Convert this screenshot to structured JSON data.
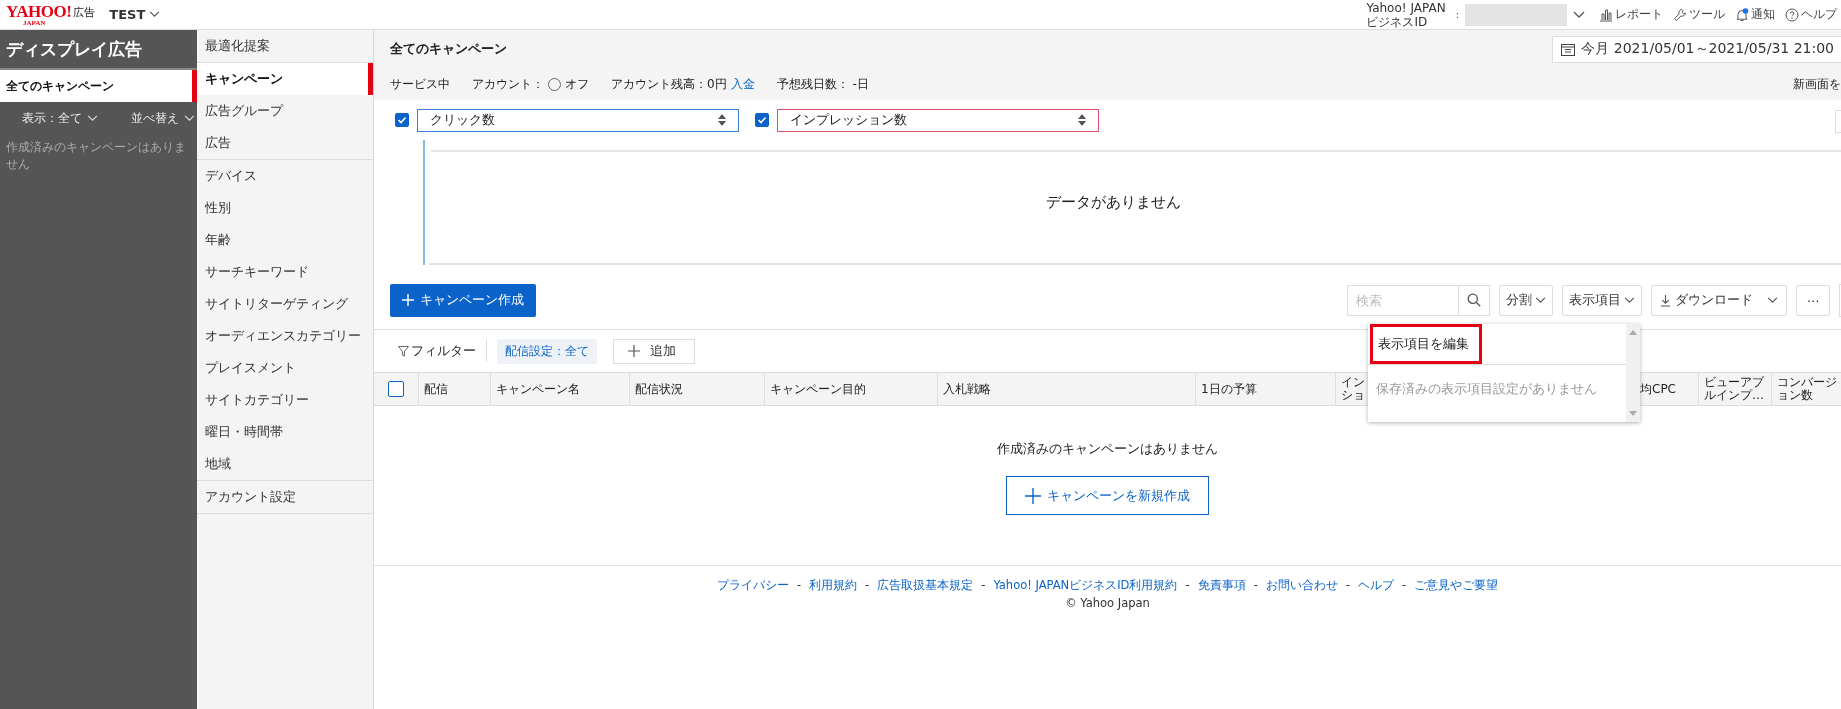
{
  "header": {
    "logo": {
      "brand": "YAHOO!",
      "sub": "JAPAN",
      "product": "広告"
    },
    "account": "TEST",
    "business_id_label": [
      "Yahoo! JAPAN",
      "ビジネスID"
    ],
    "separator": ":",
    "links": [
      {
        "label": "レポート",
        "kind": "chart"
      },
      {
        "label": "ツール",
        "kind": "wrench"
      },
      {
        "label": "通知",
        "kind": "bell",
        "badge": true
      },
      {
        "label": "ヘルプ",
        "kind": "help"
      }
    ]
  },
  "sidebar": {
    "title": "ディスプレイ広告",
    "items": [
      {
        "label": "全てのキャンペーン",
        "selected": true
      }
    ],
    "filters": [
      "表示：全て",
      "並べ替え"
    ],
    "empty": "作成済みのキャンペーンはありません"
  },
  "nav": {
    "groups": [
      {
        "items": [
          {
            "label": "最適化提案",
            "selected": false
          }
        ]
      },
      {
        "items": [
          {
            "label": "キャンペーン",
            "selected": true
          },
          {
            "label": "広告グループ",
            "selected": false
          },
          {
            "label": "広告",
            "selected": false
          }
        ]
      },
      {
        "items": [
          {
            "label": "デバイス",
            "selected": false
          },
          {
            "label": "性別",
            "selected": false
          },
          {
            "label": "年齢",
            "selected": false
          },
          {
            "label": "サーチキーワード",
            "selected": false
          },
          {
            "label": "サイトリターゲティング",
            "selected": false
          },
          {
            "label": "オーディエンスカテゴリー",
            "selected": false
          },
          {
            "label": "プレイスメント",
            "selected": false
          },
          {
            "label": "サイトカテゴリー",
            "selected": false
          },
          {
            "label": "曜日・時間帯",
            "selected": false
          },
          {
            "label": "地域",
            "selected": false
          }
        ]
      },
      {
        "items": [
          {
            "label": "アカウント設定",
            "selected": false
          }
        ]
      }
    ]
  },
  "main": {
    "title": "全てのキャンペーン",
    "date_range": "今月 2021/05/01～2021/05/31 21:00",
    "status": {
      "service": "サービス中",
      "account_label": "アカウント：",
      "account_radio": {
        "label": "オフ",
        "selected": false
      },
      "balance": "アカウント残高：0円",
      "deposit_link": "入金",
      "days_left": "予想残日数： -日",
      "new_screen": "新画面を"
    },
    "metrics": [
      {
        "checked": true,
        "label": "クリック数",
        "color": "#3a7fd0"
      },
      {
        "checked": true,
        "label": "インプレッション数",
        "color": "#e0506e"
      }
    ],
    "chart": {
      "empty_message": "データがありません"
    },
    "toolbar": {
      "create_button": "キャンペーン作成",
      "search": {
        "placeholder": "検索"
      },
      "buttons": [
        {
          "label": "分割",
          "kind": "dropdown"
        },
        {
          "label": "表示項目",
          "kind": "dropdown"
        },
        {
          "label": "ダウンロード",
          "kind": "download"
        },
        {
          "label": "⋯",
          "kind": "more"
        }
      ]
    },
    "filter": {
      "label": "フィルター",
      "chips": [
        "配信設定：全て"
      ],
      "add_button": "追加"
    },
    "table": {
      "select_all": {
        "checked": false
      },
      "columns": [
        "配信",
        "キャンペーン名",
        "配信状況",
        "キャンペーン目的",
        "入札戦略",
        "1日の予算",
        "インショ",
        "均CPC",
        "ビューアブルインプ…",
        "コンバージョン数"
      ],
      "empty": "作成済みのキャンペーンはありません",
      "new_button": "キャンペーンを新規作成"
    },
    "column_menu": {
      "items": [
        {
          "label": "表示項目を編集",
          "highlighted": true
        }
      ],
      "empty": "保存済みの表示項目設定がありません"
    }
  },
  "footer": {
    "links": [
      "プライバシー",
      "利用規約",
      "広告取扱基本規定",
      "Yahoo! JAPANビジネスID利用規約",
      "免責事項",
      "お問い合わせ",
      "ヘルプ",
      "ご意見やご要望"
    ],
    "separator": "-",
    "copyright": "© Yahoo Japan"
  }
}
